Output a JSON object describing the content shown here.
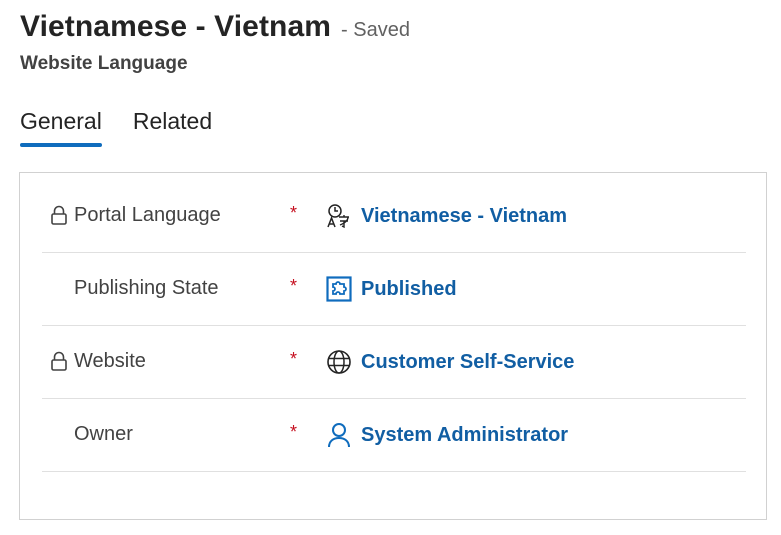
{
  "header": {
    "title": "Vietnamese - Vietnam",
    "save_status": "- Saved",
    "entity": "Website Language"
  },
  "tabs": [
    {
      "label": "General",
      "active": true
    },
    {
      "label": "Related",
      "active": false
    }
  ],
  "fields": [
    {
      "label": "Portal Language",
      "locked": true,
      "required": "*",
      "value": "Vietnamese - Vietnam",
      "icon": "language-icon"
    },
    {
      "label": "Publishing State",
      "locked": false,
      "required": "*",
      "value": "Published",
      "icon": "publishing-state-icon"
    },
    {
      "label": "Website",
      "locked": true,
      "required": "*",
      "value": "Customer Self-Service",
      "icon": "globe-icon"
    },
    {
      "label": "Owner",
      "locked": false,
      "required": "*",
      "value": "System Administrator",
      "icon": "person-icon"
    }
  ],
  "colors": {
    "accent": "#0f6cbd",
    "link": "#115ea3",
    "required": "#c50f1f"
  }
}
